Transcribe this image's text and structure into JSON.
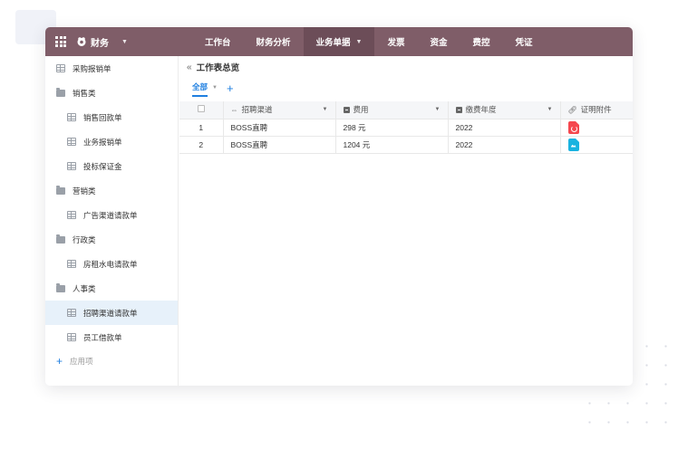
{
  "app": {
    "name": "财务"
  },
  "nav": {
    "items": [
      {
        "label": "工作台"
      },
      {
        "label": "财务分析"
      },
      {
        "label": "业务单据",
        "active": true,
        "has_dropdown": true
      },
      {
        "label": "发票"
      },
      {
        "label": "资金"
      },
      {
        "label": "费控"
      },
      {
        "label": "凭证"
      }
    ]
  },
  "sidebar": {
    "items": [
      {
        "type": "table",
        "label": "采购报销单",
        "level": 0
      },
      {
        "type": "folder",
        "label": "销售类",
        "level": 0
      },
      {
        "type": "table",
        "label": "销售回款单",
        "level": 1
      },
      {
        "type": "table",
        "label": "业务报销单",
        "level": 1
      },
      {
        "type": "table",
        "label": "投标保证金",
        "level": 1
      },
      {
        "type": "folder",
        "label": "营销类",
        "level": 0
      },
      {
        "type": "table",
        "label": "广告渠道请款单",
        "level": 1
      },
      {
        "type": "folder",
        "label": "行政类",
        "level": 0
      },
      {
        "type": "table",
        "label": "房租水电请款单",
        "level": 1
      },
      {
        "type": "folder",
        "label": "人事类",
        "level": 0
      },
      {
        "type": "table",
        "label": "招聘渠道请款单",
        "level": 1,
        "active": true
      },
      {
        "type": "table",
        "label": "员工借款单",
        "level": 1
      }
    ],
    "add_label": "应用项"
  },
  "main": {
    "breadcrumb": "工作表总览",
    "view_tab": "全部"
  },
  "table": {
    "columns": [
      {
        "label": "招聘渠道",
        "icon": "option-icon"
      },
      {
        "label": "费用",
        "icon": "number-icon"
      },
      {
        "label": "缴费年度",
        "icon": "number-icon"
      },
      {
        "label": "证明附件",
        "icon": "attachment-icon"
      }
    ],
    "rows": [
      {
        "index": "1",
        "channel": "BOSS直聘",
        "fee": "298 元",
        "year": "2022",
        "attachment": "pdf-file-icon"
      },
      {
        "index": "2",
        "channel": "BOSS直聘",
        "fee": "1204 元",
        "year": "2022",
        "attachment": "image-file-icon"
      }
    ]
  },
  "colors": {
    "topbar": "#7f5d68",
    "topbar_active": "#6c4d58",
    "accent": "#1f7fe0",
    "sidebar_active": "#e7f1fa"
  }
}
